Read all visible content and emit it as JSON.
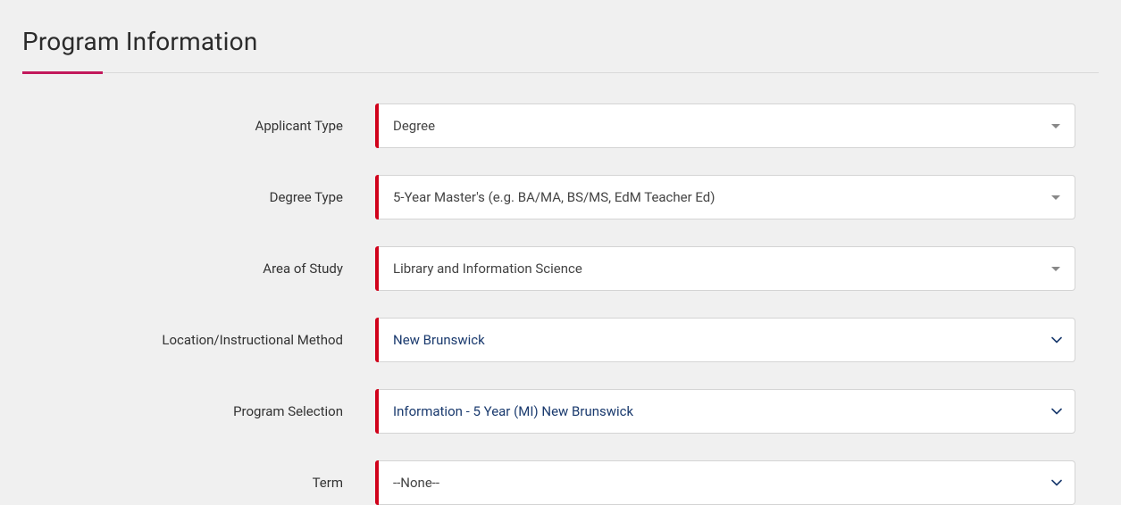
{
  "section": {
    "title": "Program Information"
  },
  "fields": {
    "applicant_type": {
      "label": "Applicant Type",
      "value": "Degree"
    },
    "degree_type": {
      "label": "Degree Type",
      "value": "5-Year Master's (e.g. BA/MA, BS/MS, EdM Teacher Ed)"
    },
    "area_of_study": {
      "label": "Area of Study",
      "value": "Library and Information Science"
    },
    "location_method": {
      "label": "Location/Instructional Method",
      "value": "New Brunswick"
    },
    "program_selection": {
      "label": "Program Selection",
      "value": "Information - 5 Year (MI) New Brunswick"
    },
    "term": {
      "label": "Term",
      "value": "--None--"
    }
  },
  "colors": {
    "accent": "#c2185b",
    "required_bar": "#d0021b"
  }
}
